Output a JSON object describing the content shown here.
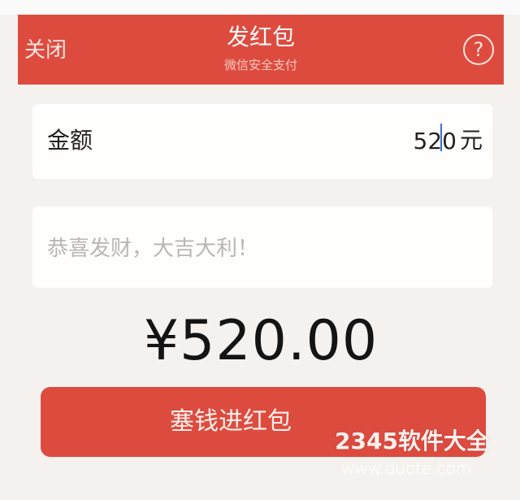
{
  "header": {
    "close_label": "关闭",
    "title": "发红包",
    "subtitle": "微信安全支付",
    "help_icon": "question-circle-icon",
    "help_glyph": "?"
  },
  "amount": {
    "label": "金额",
    "value": "520",
    "unit": "元"
  },
  "message": {
    "placeholder": "恭喜发财，大吉大利！"
  },
  "total": {
    "display": "¥520.00"
  },
  "submit": {
    "label": "塞钱进红包"
  },
  "watermark": {
    "text": "2345软件大全",
    "url": "www.duote.com"
  },
  "colors": {
    "brand_red": "#dd4b3f",
    "background": "#f5f1ee",
    "card": "#fffefd",
    "placeholder": "#b8b5b2"
  }
}
